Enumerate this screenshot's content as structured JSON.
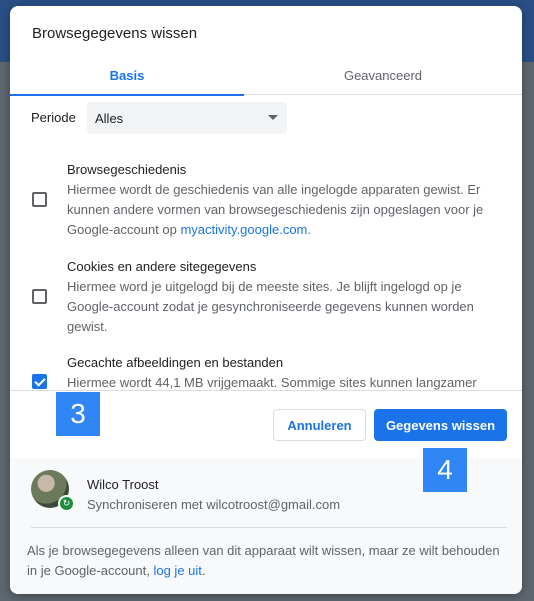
{
  "dialog": {
    "title": "Browsegegevens wissen",
    "tabs": [
      {
        "label": "Basis",
        "active": true
      },
      {
        "label": "Geavanceerd",
        "active": false
      }
    ]
  },
  "period": {
    "label": "Periode",
    "selected": "Alles"
  },
  "items": [
    {
      "title": "Browsegeschiedenis",
      "desc": "Hiermee wordt de geschiedenis van alle ingelogde apparaten gewist. Er kunnen andere vormen van browsegeschiedenis zijn opgeslagen voor je Google-account op ",
      "link": "myactivity.google.com",
      "desc_end": ".",
      "checked": false
    },
    {
      "title": "Cookies en andere sitegegevens",
      "desc": "Hiermee word je uitgelogd bij de meeste sites. Je blijft ingelogd op je Google-account zodat je gesynchroniseerde gegevens kunnen worden gewist.",
      "checked": false
    },
    {
      "title": "Gecachte afbeeldingen en bestanden",
      "desc": "Hiermee wordt 44,1 MB vrijgemaakt. Sommige sites kunnen langzamer",
      "checked": true
    }
  ],
  "buttons": {
    "cancel": "Annuleren",
    "clear": "Gegevens wissen"
  },
  "account": {
    "name": "Wilco Troost",
    "sync": "Synchroniseren met wilcotroost@gmail.com",
    "note": "Als je browsegegevens alleen van dit apparaat wilt wissen, maar ze wilt behouden in je Google-account, ",
    "note_link": "log je uit",
    "note_end": "."
  },
  "markers": {
    "m3": "3",
    "m4": "4"
  },
  "colors": {
    "accent": "#1a73e8",
    "marker": "#2f86f4",
    "sync_badge": "#1e8e3e"
  }
}
